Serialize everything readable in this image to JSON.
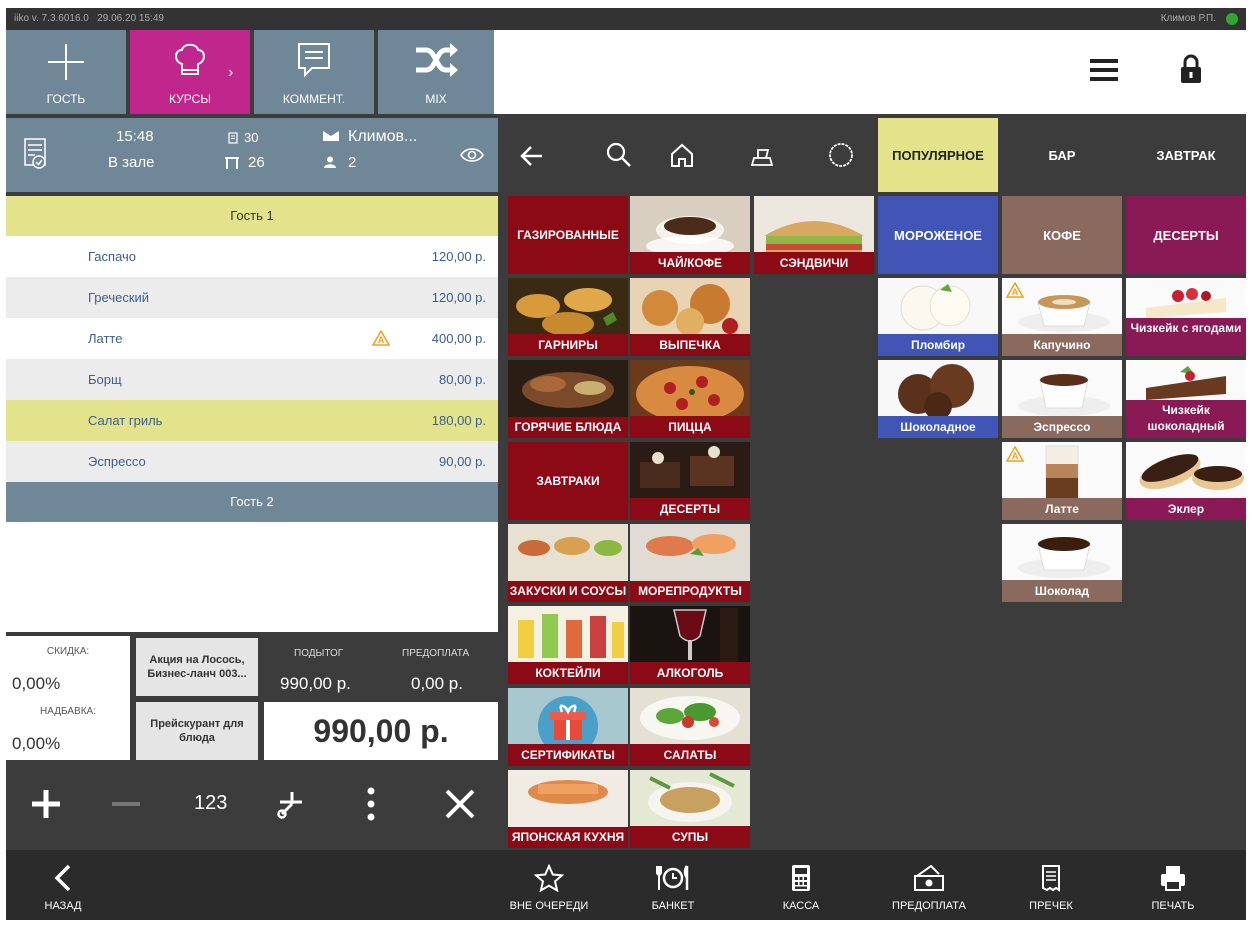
{
  "status": {
    "version": "iiko v. 7.3.6016.0",
    "datetime": "29.06.20 15:49",
    "user": "Климов Р.П."
  },
  "toolbar": [
    {
      "label": "ГОСТЬ",
      "icon": "plus-icon"
    },
    {
      "label": "КУРСЫ",
      "icon": "chef-hat-icon"
    },
    {
      "label": "КОММЕНТ.",
      "icon": "comment-icon"
    },
    {
      "label": "MIX",
      "icon": "shuffle-icon"
    }
  ],
  "order": {
    "time": "15:48",
    "location": "В зале",
    "order_num": "30",
    "table": "26",
    "waiter": "Климов...",
    "guests": "2",
    "guest1": "Гость 1",
    "guest2": "Гость 2",
    "items": [
      {
        "name": "Гаспачо",
        "price": "120,00 р."
      },
      {
        "name": "Греческий",
        "price": "120,00 р."
      },
      {
        "name": "Латте",
        "price": "400,00 р."
      },
      {
        "name": "Борщ",
        "price": "80,00 р."
      },
      {
        "name": "Салат гриль",
        "price": "180,00 р."
      },
      {
        "name": "Эспрессо",
        "price": "90,00 р."
      }
    ]
  },
  "totals": {
    "discount_label": "СКИДКА:",
    "discount_value": "0,00%",
    "surcharge_label": "НАДБАВКА:",
    "surcharge_value": "0,00%",
    "promo_button": "Акция на Лосось, Бизнес-ланч 003...",
    "pricelist_button": "Прейскурант для блюда",
    "subtotal_label": "ПОДЫТОГ",
    "subtotal_value": "990,00 р.",
    "prepay_label": "ПРЕДОПЛАТА",
    "prepay_value": "0,00 р.",
    "total": "990,00 р."
  },
  "order_actions": {
    "quantity": "123"
  },
  "category_tabs": [
    {
      "label": "ПОПУЛЯРНОЕ",
      "color": "#e3e38c"
    },
    {
      "label": "БАР"
    },
    {
      "label": "ЗАВТРАК"
    }
  ],
  "sub_tabs": [
    {
      "label": "МОРОЖЕНОЕ",
      "color": "#4055b5"
    },
    {
      "label": "КОФЕ",
      "color": "#8a6a5e"
    },
    {
      "label": "ДЕСЕРТЫ",
      "color": "#8a1a55"
    }
  ],
  "groups": [
    "ГАЗИРОВАННЫЕ",
    "ЧАЙ/КОФЕ",
    "СЭНДВИЧИ",
    "ГАРНИРЫ",
    "ВЫПЕЧКА",
    "ГОРЯЧИЕ БЛЮДА",
    "ПИЦЦА",
    "ЗАВТРАКИ",
    "ДЕСЕРТЫ",
    "ЗАКУСКИ И СОУСЫ",
    "МОРЕПРОДУКТЫ",
    "КОКТЕЙЛИ",
    "АЛКОГОЛЬ",
    "СЕРТИФИКАТЫ",
    "САЛАТЫ",
    "ЯПОНСКАЯ КУХНЯ",
    "СУПЫ"
  ],
  "products": {
    "icecream": [
      "Пломбир",
      "Шоколадное"
    ],
    "coffee": [
      "Капучино",
      "Эспрессо",
      "Латте",
      "Шоколад"
    ],
    "desserts": [
      "Чизкейк с ягодами",
      "Чизкейк шоколадный",
      "Эклер"
    ]
  },
  "bottom": [
    {
      "label": "НАЗАД",
      "icon": "back-icon"
    },
    {
      "label": "ВНЕ ОЧЕРЕДИ",
      "icon": "star-icon"
    },
    {
      "label": "БАНКЕТ",
      "icon": "banquet-icon"
    },
    {
      "label": "КАССА",
      "icon": "calculator-icon"
    },
    {
      "label": "ПРЕДОПЛАТА",
      "icon": "prepay-icon"
    },
    {
      "label": "ПРЕЧЕК",
      "icon": "receipt-icon"
    },
    {
      "label": "ПЕЧАТЬ",
      "icon": "printer-icon"
    }
  ]
}
